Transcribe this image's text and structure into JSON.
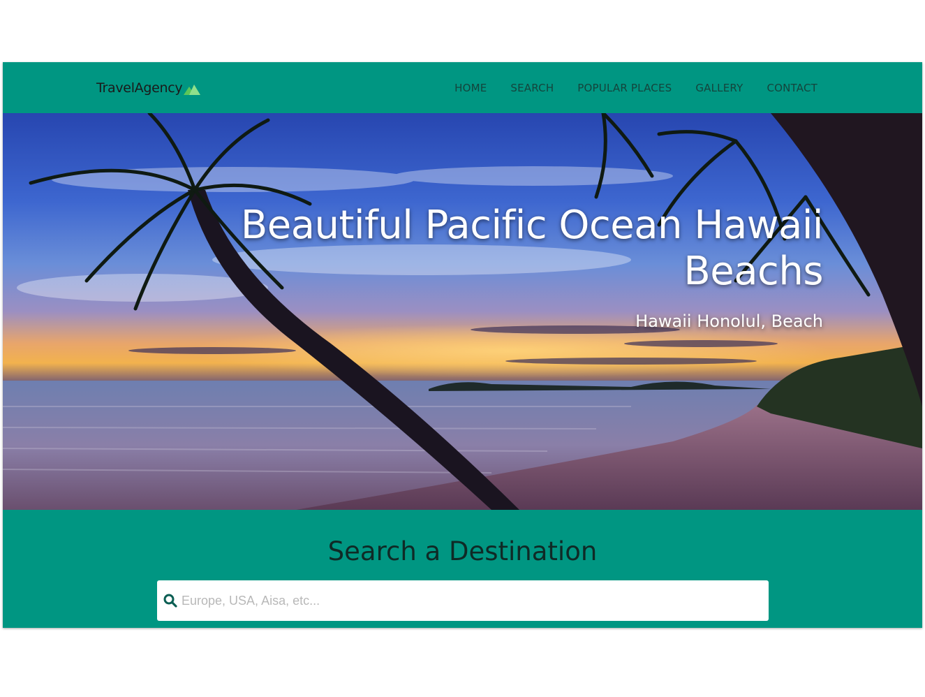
{
  "brand": {
    "name": "TravelAgency",
    "logo_icon": "mountain-logo-icon",
    "logo_color": "#7dd87a"
  },
  "nav": {
    "links": [
      "HOME",
      "SEARCH",
      "POPULAR PLACES",
      "GALLERY",
      "CONTACT"
    ]
  },
  "hero": {
    "title_line1": "Beautiful Pacific Ocean Hawaii",
    "title_line2": "Beachs",
    "subtitle": "Hawaii Honolul, Beach"
  },
  "search": {
    "heading": "Search a Destination",
    "placeholder": "Europe, USA, Aisa, etc...",
    "value": "",
    "icon": "search-icon"
  },
  "colors": {
    "accent": "#009682",
    "nav_text": "#14443c",
    "search_icon": "#0b5e53"
  }
}
